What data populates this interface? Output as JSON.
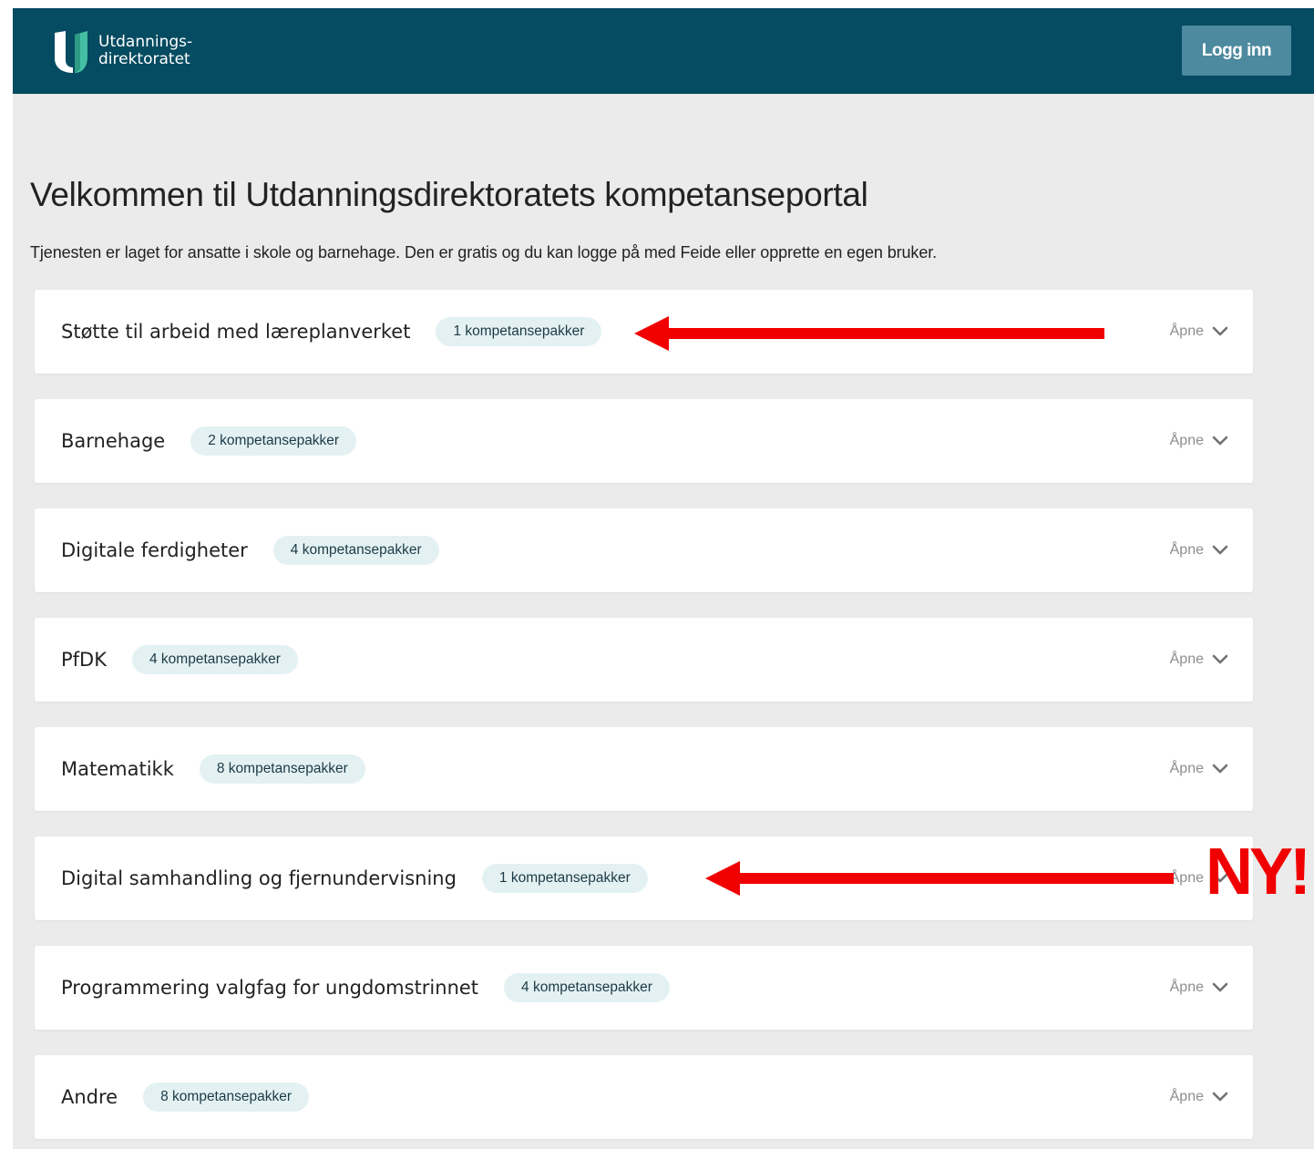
{
  "header": {
    "logo_line1": "Utdannings-",
    "logo_line2": "direktoratet",
    "login_label": "Logg inn"
  },
  "main": {
    "title": "Velkommen til Utdanningsdirektoratets kompetanseportal",
    "intro": "Tjenesten er laget for ansatte i skole og barnehage. Den er gratis og du kan logge på med Feide eller opprette en egen bruker.",
    "categories": [
      {
        "label": "Støtte til arbeid med læreplanverket",
        "badge": "1 kompetansepakker",
        "toggle": "Åpne"
      },
      {
        "label": "Barnehage",
        "badge": "2 kompetansepakker",
        "toggle": "Åpne"
      },
      {
        "label": "Digitale ferdigheter",
        "badge": "4 kompetansepakker",
        "toggle": "Åpne"
      },
      {
        "label": "PfDK",
        "badge": "4 kompetansepakker",
        "toggle": "Åpne"
      },
      {
        "label": "Matematikk",
        "badge": "8 kompetansepakker",
        "toggle": "Åpne"
      },
      {
        "label": "Digital samhandling og fjernundervisning",
        "badge": "1 kompetansepakker",
        "toggle": "Åpne"
      },
      {
        "label": "Programmering valgfag for ungdomstrinnet",
        "badge": "4 kompetansepakker",
        "toggle": "Åpne"
      },
      {
        "label": "Andre",
        "badge": "8 kompetansepakker",
        "toggle": "Åpne"
      }
    ]
  },
  "annotation": {
    "new_label": "NY!",
    "color": "#f00000"
  },
  "colors": {
    "header_bg": "#054b61",
    "login_bg": "#4d8aa0",
    "page_bg": "#ebebeb",
    "badge_bg": "#e4f1f3"
  }
}
